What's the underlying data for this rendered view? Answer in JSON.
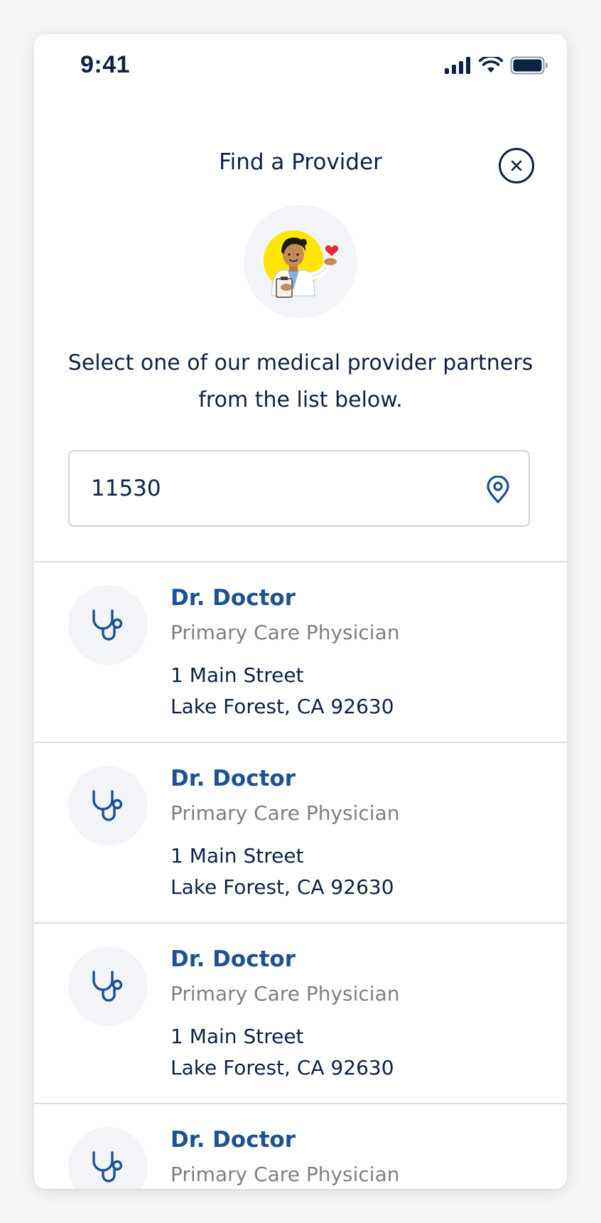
{
  "status_bar": {
    "time": "9:41"
  },
  "header": {
    "title": "Find a Provider",
    "close_icon": "close-circle-icon"
  },
  "illustration": {
    "icon": "doctor-illustration"
  },
  "intro_text": "Select one of our medical provider partners from the list below.",
  "search": {
    "value": "11530",
    "placeholder": "",
    "icon": "location-pin-icon"
  },
  "providers": [
    {
      "name": "Dr. Doctor",
      "specialty": "Primary Care Physician",
      "street": "1 Main Street",
      "city": "Lake Forest, CA 92630",
      "icon": "stethoscope-icon"
    },
    {
      "name": "Dr. Doctor",
      "specialty": "Primary Care Physician",
      "street": "1 Main Street",
      "city": "Lake Forest, CA 92630",
      "icon": "stethoscope-icon"
    },
    {
      "name": "Dr. Doctor",
      "specialty": "Primary Care Physician",
      "street": "1 Main Street",
      "city": "Lake Forest, CA 92630",
      "icon": "stethoscope-icon"
    },
    {
      "name": "Dr. Doctor",
      "specialty": "Primary Care Physician",
      "street": "",
      "city": "",
      "icon": "stethoscope-icon"
    }
  ],
  "colors": {
    "text_primary": "#0d2245",
    "accent_blue": "#1b5296",
    "text_secondary": "#7d7f84",
    "divider": "#dcdde0",
    "icon_bg": "#f2f4f7",
    "illustration_yellow": "#ffe600",
    "heart_red": "#e5283a"
  }
}
